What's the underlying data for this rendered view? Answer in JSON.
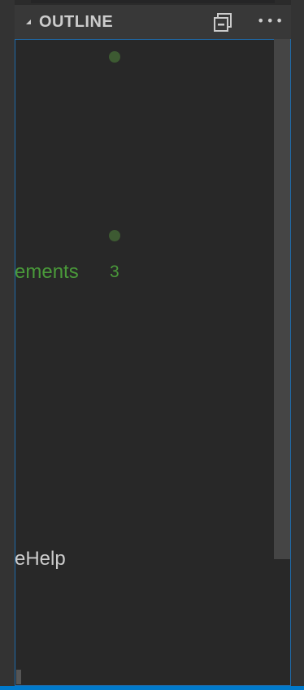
{
  "header": {
    "title": "OUTLINE",
    "collapse_icon": "collapse-all-icon",
    "more_icon": "more-actions-icon",
    "more_glyph": "•••"
  },
  "outline": {
    "rows": [
      {
        "label": "ements",
        "badge": "3",
        "color": "#4a9a3a"
      },
      {
        "label": "eHelp",
        "color": "#cccccc"
      }
    ]
  },
  "colors": {
    "accent": "#007acc",
    "focus_border": "#1f6aa8",
    "problem_dot": "#3d5a32",
    "green_text": "#4a9a3a"
  }
}
